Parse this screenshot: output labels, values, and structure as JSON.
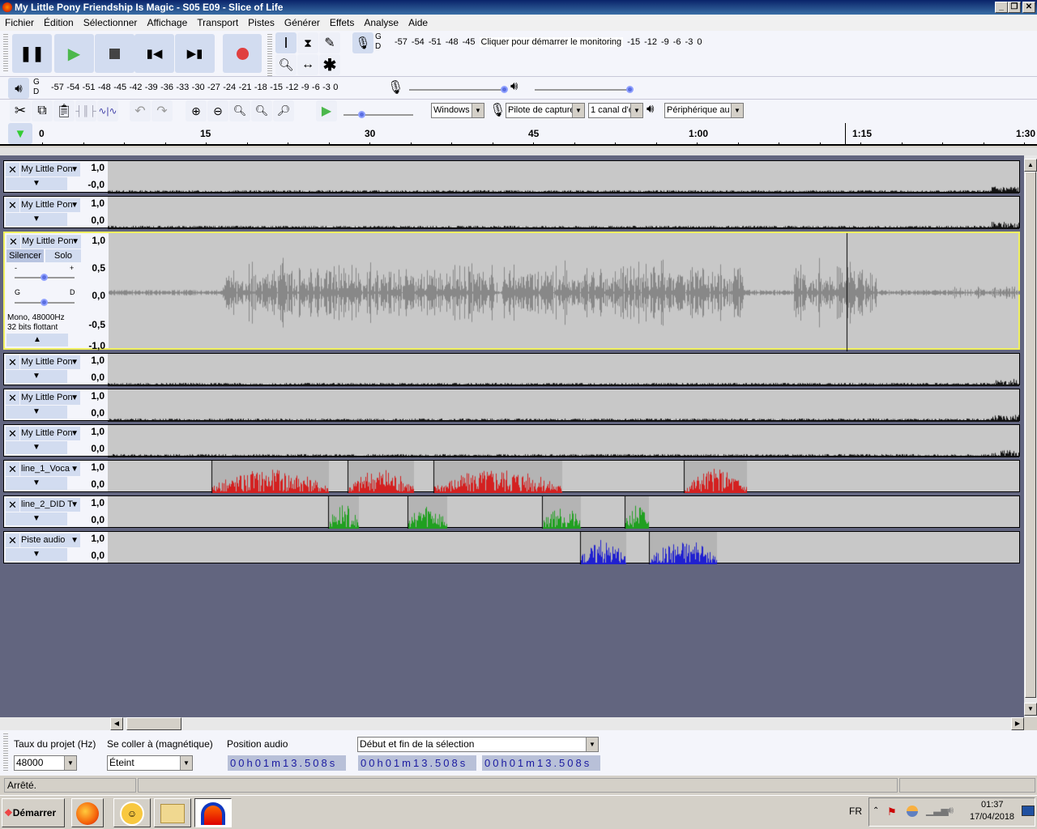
{
  "window": {
    "title": "My Little Pony Friendship Is Magic - S05 E09 - Slice of Life",
    "controls": [
      "_",
      "❐",
      "✕"
    ]
  },
  "menu": [
    "Fichier",
    "Édition",
    "Sélectionner",
    "Affichage",
    "Transport",
    "Pistes",
    "Générer",
    "Effets",
    "Analyse",
    "Aide"
  ],
  "record_meter": {
    "channels": [
      "G",
      "D"
    ],
    "scale_left": [
      "-57",
      "-54",
      "-51",
      "-48",
      "-45"
    ],
    "prompt": "Cliquer pour démarrer le monitoring",
    "scale_right": [
      "-15",
      "-12",
      "-9",
      "-6",
      "-3",
      "0"
    ]
  },
  "play_meter": {
    "channels": [
      "G",
      "D"
    ],
    "scale": [
      "-57",
      "-54",
      "-51",
      "-48",
      "-45",
      "-42",
      "-39",
      "-36",
      "-33",
      "-30",
      "-27",
      "-24",
      "-21",
      "-18",
      "-15",
      "-12",
      "-9",
      "-6",
      "-3",
      "0"
    ]
  },
  "mixer": {
    "record_volume": 1.0,
    "playback_volume": 1.0,
    "minus": "-",
    "plus": "+"
  },
  "play_speed": 0.25,
  "devices": {
    "host": "Windows",
    "input": "Pilote de capture",
    "channels": "1 canal d'e",
    "output": "Périphérique au"
  },
  "ruler": {
    "labels": [
      "0",
      "15",
      "30",
      "45",
      "1:00",
      "1:15",
      "1:30"
    ]
  },
  "tracks": [
    {
      "name": "My Little Pon",
      "top": "1,0",
      "bottom": "-0,0"
    },
    {
      "name": "My Little Pon",
      "top": "1,0",
      "bottom": "0,0"
    },
    {
      "name": "My Little Pon",
      "scale": [
        "1,0",
        "0,5",
        "0,0",
        "-0,5",
        "-1,0"
      ],
      "mute": "Silencer",
      "solo": "Solo",
      "gain_minus": "-",
      "gain_plus": "+",
      "pan_left": "G",
      "pan_right": "D",
      "info1": "Mono, 48000Hz",
      "info2": "32 bits flottant"
    },
    {
      "name": "My Little Pon",
      "top": "1,0",
      "bottom": "0,0"
    },
    {
      "name": "My Little Pon",
      "top": "1,0",
      "bottom": "0,0"
    },
    {
      "name": "My Little Pon",
      "top": "1,0",
      "bottom": "0,0"
    },
    {
      "name": "line_1_Voca",
      "top": "1,0",
      "bottom": "0,0",
      "color": "#d42020"
    },
    {
      "name": "line_2_DID T",
      "top": "1,0",
      "bottom": "0,0",
      "color": "#20a020"
    },
    {
      "name": "Piste audio",
      "top": "1,0",
      "bottom": "0,0",
      "color": "#2020d0"
    }
  ],
  "selection": {
    "rate_label": "Taux du projet (Hz)",
    "rate": "48000",
    "snap_label": "Se coller à (magnétique)",
    "snap": "Éteint",
    "pos_label": "Position audio",
    "position": "00h01m13.508s",
    "sel_mode": "Début et fin de la sélection",
    "start": "00h01m13.508s",
    "end": "00h01m13.508s"
  },
  "status": "Arrêté.",
  "taskbar": {
    "start": "Démarrer",
    "lang": "FR",
    "time": "01:37",
    "date": "17/04/2018"
  }
}
